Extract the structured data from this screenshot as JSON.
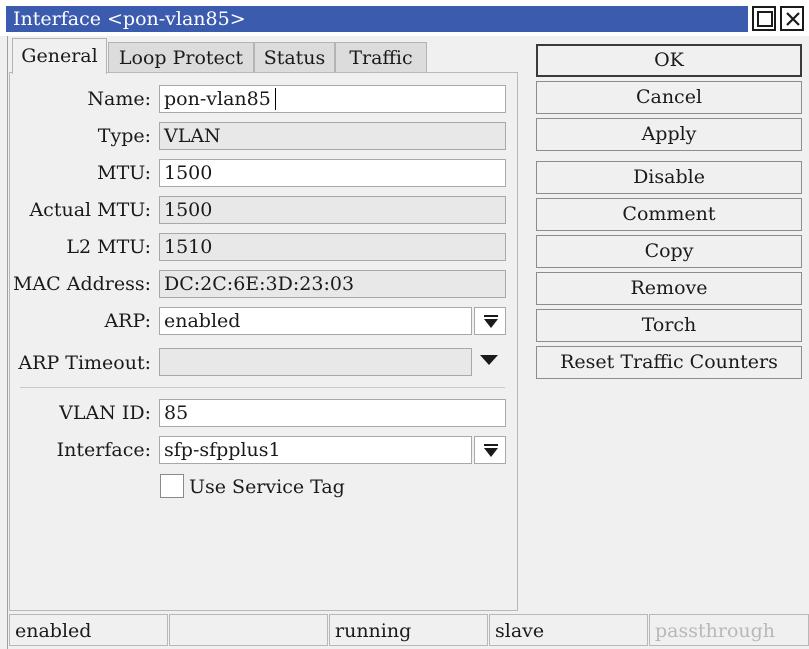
{
  "window": {
    "title": "Interface <pon-vlan85>",
    "maximize_icon": "maximize-icon",
    "close_icon": "close-icon"
  },
  "tabs": [
    {
      "label": "General",
      "active": true
    },
    {
      "label": "Loop Protect"
    },
    {
      "label": "Status"
    },
    {
      "label": "Traffic"
    }
  ],
  "form": {
    "name": {
      "label": "Name:",
      "value": "pon-vlan85"
    },
    "type": {
      "label": "Type:",
      "value": "VLAN"
    },
    "mtu": {
      "label": "MTU:",
      "value": "1500"
    },
    "actual_mtu": {
      "label": "Actual MTU:",
      "value": "1500"
    },
    "l2_mtu": {
      "label": "L2 MTU:",
      "value": "1510"
    },
    "mac_address": {
      "label": "MAC Address:",
      "value": "DC:2C:6E:3D:23:03"
    },
    "arp": {
      "label": "ARP:",
      "value": "enabled"
    },
    "arp_timeout": {
      "label": "ARP Timeout:",
      "value": ""
    },
    "vlan_id": {
      "label": "VLAN ID:",
      "value": "85"
    },
    "interface": {
      "label": "Interface:",
      "value": "sfp-sfpplus1"
    },
    "use_service_tag": {
      "label": "Use Service Tag",
      "checked": false
    }
  },
  "buttons": {
    "ok": "OK",
    "cancel": "Cancel",
    "apply": "Apply",
    "disable": "Disable",
    "comment": "Comment",
    "copy": "Copy",
    "remove": "Remove",
    "torch": "Torch",
    "reset_traffic_counters": "Reset Traffic Counters"
  },
  "status_bar": {
    "enabled": "enabled",
    "empty": "",
    "running": "running",
    "slave": "slave",
    "passthrough": "passthrough"
  },
  "colors": {
    "title_bar": "#3b5cae",
    "status_dim": "#b8b8b8"
  }
}
